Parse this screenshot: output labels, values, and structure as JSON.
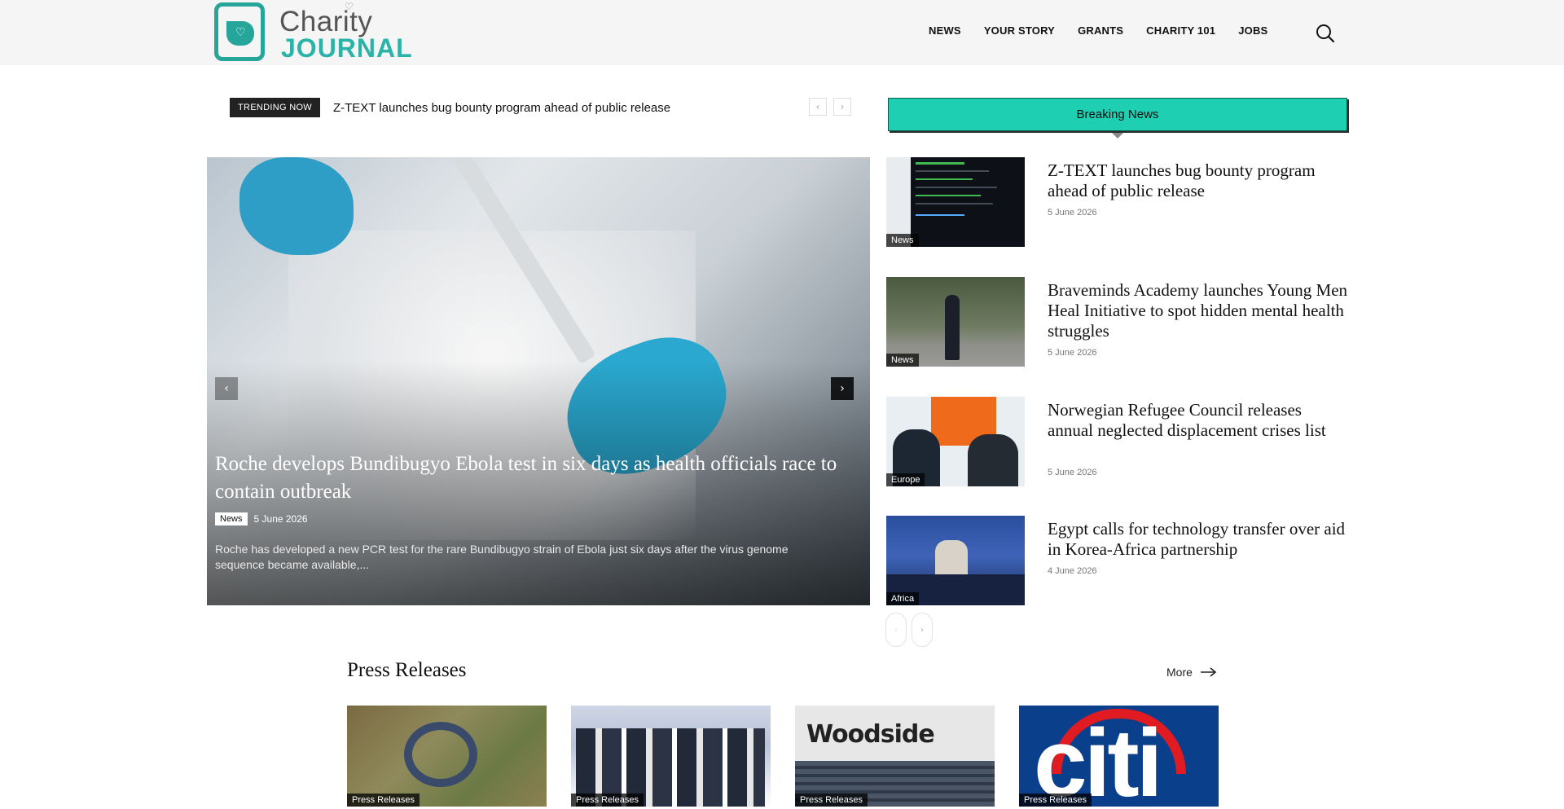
{
  "header": {
    "logo_top": "Charity",
    "logo_bottom": "JOURNAL",
    "nav": [
      "NEWS",
      "YOUR STORY",
      "GRANTS",
      "CHARITY 101",
      "JOBS"
    ]
  },
  "trending": {
    "label": "TRENDING NOW",
    "headline": "Z-TEXT launches bug bounty program ahead of public release"
  },
  "hero": {
    "title": "Roche develops Bundibugyo Ebola test in six days as health officials race to contain outbreak",
    "category": "News",
    "date": "5 June 2026",
    "excerpt": "Roche has developed a new PCR test for the rare Bundibugyo strain of Ebola just six days after the virus genome sequence became available,..."
  },
  "breaking": {
    "title": "Breaking News",
    "items": [
      {
        "title": "Z-TEXT launches bug bounty program ahead of public release",
        "date": "5 June 2026",
        "category": "News"
      },
      {
        "title": "Braveminds Academy launches Young Men Heal Initiative to spot hidden mental health struggles",
        "date": "5 June 2026",
        "category": "News"
      },
      {
        "title": "Norwegian Refugee Council releases annual neglected displacement crises list",
        "date": "5 June 2026",
        "category": "Europe"
      },
      {
        "title": "Egypt calls for technology transfer over aid in Korea-Africa partnership",
        "date": "4 June 2026",
        "category": "Africa"
      }
    ]
  },
  "press": {
    "title": "Press Releases",
    "more": "More",
    "cards": [
      {
        "category": "Press Releases"
      },
      {
        "category": "Press Releases"
      },
      {
        "category": "Press Releases",
        "logo_text": "Woodside"
      },
      {
        "category": "Press Releases",
        "logo_text": "citi"
      }
    ]
  }
}
